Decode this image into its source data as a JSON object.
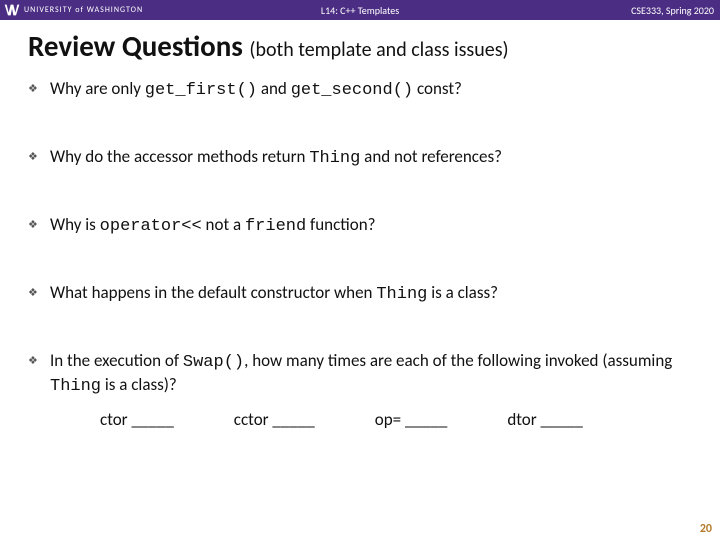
{
  "header": {
    "brand": "UNIVERSITY of WASHINGTON",
    "center": "L14:  C++ Templates",
    "right": "CSE333, Spring 2020"
  },
  "title": {
    "main": "Review Questions",
    "sub": "(both template and class issues)"
  },
  "q1": {
    "p0": "Why are only ",
    "c0": "get_first()",
    "p1": " and ",
    "c1": "get_second()",
    "p2": " const?"
  },
  "q2": {
    "p0": "Why do the accessor methods return ",
    "c0": "Thing",
    "p1": " and not references?"
  },
  "q3": {
    "p0": "Why is ",
    "c0": "operator<<",
    "p1": " not a ",
    "c1": "friend",
    "p2": " function?"
  },
  "q4": {
    "p0": "What happens in the default constructor when ",
    "c0": "Thing",
    "p1": " is a class?"
  },
  "q5": {
    "p0": "In the execution of ",
    "c0": "Swap()",
    "p1": ", how many times are each of the following invoked (assuming ",
    "c1": "Thing",
    "p2": " is a class)?"
  },
  "blanks": {
    "b0": "ctor _____",
    "b1": "cctor _____",
    "b2": "op= _____",
    "b3": "dtor _____"
  },
  "page": "20"
}
